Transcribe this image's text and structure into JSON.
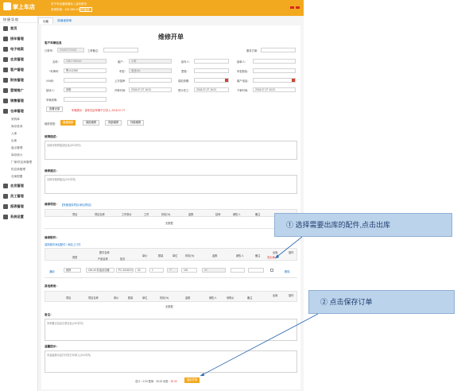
{
  "topbar": {
    "brand": "掌上车店",
    "notice": "关于车店营收增长 | 活动资讯",
    "hotline": "咨询热线：400-382-0920",
    "trial_button": "升级版"
  },
  "sidebar": {
    "header": "快捷导航",
    "items": [
      {
        "label": "首页",
        "icon": "home-icon"
      },
      {
        "label": "接车管理",
        "icon": "car-icon"
      },
      {
        "label": "电子档案",
        "icon": "folder-icon"
      },
      {
        "label": "会员管理",
        "icon": "member-icon"
      },
      {
        "label": "客户管理",
        "icon": "customer-icon"
      },
      {
        "label": "财务管理",
        "icon": "finance-icon"
      },
      {
        "label": "营销推广",
        "icon": "marketing-icon"
      },
      {
        "label": "销售管理",
        "icon": "sales-icon"
      },
      {
        "label": "仓库管理",
        "icon": "warehouse-icon"
      }
    ],
    "subitems": [
      "采购单",
      "库存查询",
      "入库",
      "出库",
      "盘点管理",
      "库存统计",
      "厂家/供应商管理",
      "供应商管理",
      "仓库配置"
    ],
    "bottom_items": [
      {
        "label": "会员管理",
        "icon": "member2-icon"
      },
      {
        "label": "员工管理",
        "icon": "staff-icon"
      },
      {
        "label": "报表管理",
        "icon": "report-icon"
      },
      {
        "label": "系统设置",
        "icon": "settings-icon"
      }
    ]
  },
  "tabs": [
    {
      "label": "功能",
      "active": true
    },
    {
      "label": "新增维修单",
      "active": false
    }
  ],
  "page": {
    "title": "维修开单",
    "section_customer": "客户车辆信息",
    "order_no_label": "订单号：",
    "order_no": "201807270002",
    "work_order_label": "工单备注：",
    "ref_label": "服务方案：",
    "name_label": "名称：",
    "name_value": "15827459464",
    "license_label": "*车牌号：",
    "license_prefix": "鄂",
    "license_value": "A12345",
    "customer_label": "客户：",
    "customer_value": "小明",
    "model_label": "车型：",
    "model_value": "奥迪A6L",
    "advisor_label": "接车人：",
    "advisor_label2": "接单人：",
    "vin_label": "VIN码：",
    "mileage_label": "里程：",
    "phone_label": "客户电话：",
    "color_label": "车型颜色：",
    "last_label": "上次保养：",
    "insure_label": "保险到期：",
    "next_label": "下次保养：",
    "remark_label": "车辆备注：",
    "staff_label": "接待人：",
    "staff_value": "张明",
    "date1_label": "开单时间：",
    "date1": "2018-07-27 16:21",
    "date2_label": "预计完工：",
    "date2": "2018-07-27 16:21",
    "date3_label": "下单时间：",
    "date3": "2018-07-27 16:21",
    "service_label": "车辆说明：",
    "record_button": "查看记录",
    "record_hint": "车辆提示：该车在此车辆下已存入 2018-07-27",
    "repair_type_label": "维修类型：",
    "repair_types": [
      "普通维修",
      "保险维修",
      "内部维修",
      "外部维修"
    ],
    "fault_label": "故障描述：",
    "fault_placeholder": "请填写故障描述信息(200字内)",
    "advice_label": "维修建议：",
    "advice_placeholder": "请填写维修建议(200字内)",
    "service_items_label": "维修项目：",
    "service_items_link": "【快速选择项目/添加项目】",
    "service_headers": [
      "项目",
      "项目名称",
      "工时单价",
      "工时",
      "折扣(%)",
      "金额",
      "技师",
      "销售人",
      "备注",
      "操作"
    ],
    "empty_text": "无数据",
    "parts_label": "维修配件：",
    "parts_link": "选择配件添加配件 / 添加上门件",
    "parts_headers": [
      "类型",
      "配件名称",
      "产品名称",
      "批次",
      "单价",
      "数量",
      "单位",
      "折扣(%)",
      "金额",
      "销售人",
      "备注",
      "出库",
      "操作"
    ],
    "parts_row": {
      "type_label": "通用",
      "category": "维修",
      "part_name": "OM-40 机油滤清器",
      "batch": "PC-20180727",
      "price": "30",
      "qty": "1",
      "unit": "个",
      "discount": "100",
      "amount": "30",
      "stock_label": "未出库",
      "action": "删除"
    },
    "other_label": "其他费用：",
    "other_headers": [
      "项目",
      "项目名称",
      "单价",
      "数量",
      "单位",
      "折扣(%)",
      "金额",
      "销售人",
      "采购价",
      "备注",
      "出库",
      "操作"
    ],
    "remark_section": "备注：",
    "remark_placeholder": "本单备注信息记录在此(200字内)",
    "prompt_label": "温馨提示：",
    "prompt_placeholder": "本温馨提示会打印在打印单上(200字内)",
    "total_text": "总计：0.00 整单：30.00 优惠：",
    "total_amount": "30.00",
    "save_button": "保存开单"
  },
  "annotations": {
    "callout1": "① 选择需要出库的配件,点击出库",
    "callout2": "② 点击保存订单"
  }
}
